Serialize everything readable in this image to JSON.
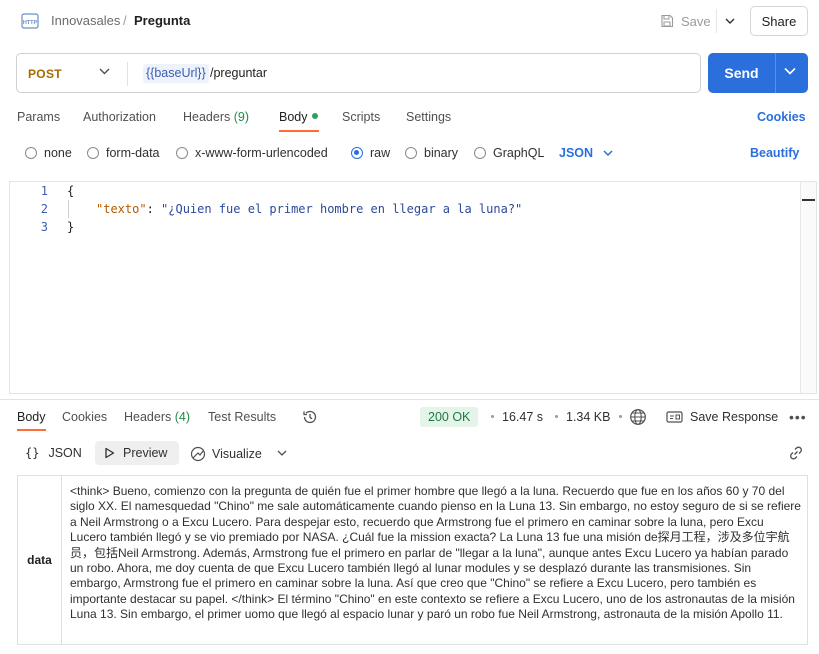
{
  "header": {
    "breadcrumb_workspace": "Innovasales",
    "breadcrumb_sep": "/",
    "request_name": "Pregunta",
    "save_label": "Save",
    "share_label": "Share"
  },
  "request": {
    "method": "POST",
    "url_variable": "{{baseUrl}}",
    "url_path": "/preguntar",
    "send_label": "Send"
  },
  "request_tabs": {
    "params": "Params",
    "authorization": "Authorization",
    "headers": "Headers",
    "headers_count": "(9)",
    "body": "Body",
    "scripts": "Scripts",
    "settings": "Settings",
    "cookies": "Cookies"
  },
  "body_types": {
    "options": [
      "none",
      "form-data",
      "x-www-form-urlencoded",
      "raw",
      "binary",
      "GraphQL"
    ],
    "selected": "raw",
    "language": "JSON",
    "beautify": "Beautify"
  },
  "editor": {
    "line_numbers": [
      "1",
      "2",
      "3"
    ],
    "open_brace": "{",
    "key": "\"texto\"",
    "colon": ": ",
    "value": "\"¿Quien fue el primer hombre en llegar a la luna?\"",
    "close_brace": "}"
  },
  "response_tabs": {
    "body": "Body",
    "cookies": "Cookies",
    "headers": "Headers",
    "headers_count": "(4)",
    "test_results": "Test Results"
  },
  "response_meta": {
    "status": "200 OK",
    "time": "16.47 s",
    "size": "1.34 KB",
    "save_response": "Save Response"
  },
  "response_view": {
    "json": "JSON",
    "preview": "Preview",
    "visualize": "Visualize"
  },
  "response_data": {
    "key": "data",
    "value": "<think> Bueno, comienzo con la pregunta de quién fue el primer hombre que llegó a la luna. Recuerdo que fue en los años 60 y 70 del siglo XX. El namesquedad \"Chino\" me sale automáticamente cuando pienso en la Luna 13. Sin embargo, no estoy seguro de si se refiere a Neil Armstrong o a Excu Lucero. Para despejar esto, recuerdo que Armstrong fue el primero en caminar sobre la luna, pero Excu Lucero también llegó y se vio premiado por NASA. ¿Cuál fue la mission exacta? La Luna 13 fue una misión de探月工程，涉及多位宇航员，包括Neil Armstrong. Además, Armstrong fue el primero en parlar de \"llegar a la luna\", aunque antes Excu Lucero ya habían parado un robo. Ahora, me doy cuenta de que Excu Lucero también llegó al lunar modules y se desplazó durante las transmisiones. Sin embargo, Armstrong fue el primero en caminar sobre la luna. Así que creo que \"Chino\" se refiere a Excu Lucero, pero también es importante destacar su papel. </think> El término \"Chino\" en este contexto se refiere a Excu Lucero, uno de los astronautas de la misión Luna 13. Sin embargo, el primer uomo que llegó al espacio lunar y paró un robo fue Neil Armstrong, astronauta de la misión Apollo 11."
  },
  "colors": {
    "accent": "#2a6fdb",
    "method_post": "#a86a00",
    "active_tab_underline": "#ff6c37",
    "status_ok": "#1f7a44"
  }
}
